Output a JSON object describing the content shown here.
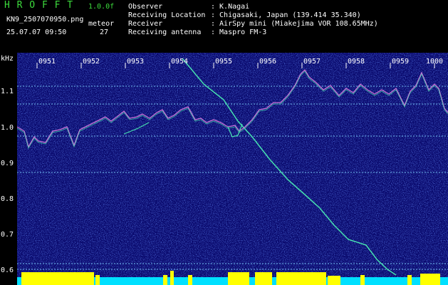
{
  "header": {
    "app_name": "H R O F F T",
    "version": "1.0.0f",
    "filename": "KN9_2507070950.png",
    "meteor_label": "meteor",
    "meteor_count": "27",
    "datetime": "25.07.07 09:50",
    "info_rows": [
      {
        "label": "Observer",
        "value": ": K.Nagai"
      },
      {
        "label": "Receiving Location",
        "value": ": Chigasaki, Japan (139.414 35.340)"
      },
      {
        "label": "Receiver",
        "value": ": AirSpy mini (Miakejima VOR 108.65MHz)"
      },
      {
        "label": "Receiving antenna",
        "value": ": Maspro FM-3"
      }
    ]
  },
  "spectrogram": {
    "y_unit": "kHz",
    "y_ticks": [
      "1.1",
      "1.0",
      "0.9",
      "0.8",
      "0.7",
      "0.6"
    ],
    "time_ticks": [
      "0951",
      "0952",
      "0953",
      "0954",
      "0955",
      "0956",
      "0957",
      "0958",
      "0959",
      "1000"
    ],
    "colors": {
      "background": "#0a0a6e",
      "noise": "#2a4cff",
      "trace": "#46e0b0",
      "meteor_bar": "#ffff00",
      "baseline": "#00e0ff"
    }
  }
}
